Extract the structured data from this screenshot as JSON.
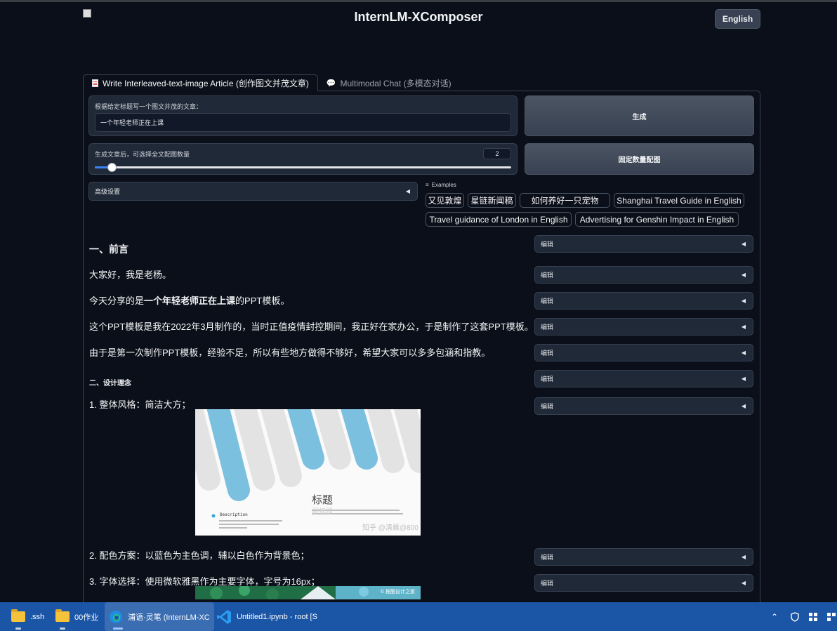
{
  "header": {
    "title": "InternLM-XComposer",
    "language_button": "English"
  },
  "tabs": [
    {
      "label": "Write Interleaved-text-image Article (创作图文并茂文章)",
      "active": true
    },
    {
      "label": "Multimodal Chat (多模态对话)",
      "active": false
    }
  ],
  "form": {
    "topic_label": "根据给定标题写一个图文并茂的文章：",
    "topic_value": "一个年轻老师正在上课",
    "generate_button": "生成",
    "image_count_label": "生成文章后，可选择全文配图数量",
    "image_count_value": "2",
    "image_count_fraction": 0.04,
    "fixed_count_button": "固定数量配图",
    "advanced_settings": "高级设置"
  },
  "examples": {
    "label": "Examples",
    "items": [
      "又见敦煌",
      "星链新闻稿",
      "如何养好一只宠物",
      "Shanghai Travel Guide in English",
      "Travel guidance of London in English",
      "Advertising for Genshin Impact in English"
    ]
  },
  "article": {
    "heading": "一、前言",
    "p1": "大家好，我是老杨。",
    "p2_pre": "今天分享的是",
    "p2_bold": "一个年轻老师正在上课",
    "p2_post": "的PPT模板。",
    "p3": "这个PPT模板是我在2022年3月制作的，当时正值疫情封控期间，我正好在家办公，于是制作了这套PPT模板。",
    "p4": "由于是第一次制作PPT模板，经验不足，所以有些地方做得不够好，希望大家可以多多包涵和指教。",
    "subheading": "二、设计理念",
    "item1": "1. 整体风格：简洁大方；",
    "item2": "2. 配色方案：以蓝色为主色调，辅以白色作为背景色；",
    "item3": "3. 字体选择：使用微软雅黑作为主要字体，字号为16px；"
  },
  "figure1": {
    "title": "标题",
    "subtitle": "副标题",
    "description_heading": "Description",
    "watermark": "知乎 @清晨@800"
  },
  "figure2": {
    "watermark": "© 推酷设计之家"
  },
  "edit_label": "编辑",
  "taskbar": {
    "items": [
      ".ssh",
      "00作业",
      "浦语·灵笔 (InternLM-XC",
      "Untitled1.ipynb - root [S"
    ]
  },
  "colors": {
    "background": "#0b0f19",
    "panel": "#1f2937",
    "accent": "#3b82f6",
    "taskbar": "#1b56a6"
  }
}
